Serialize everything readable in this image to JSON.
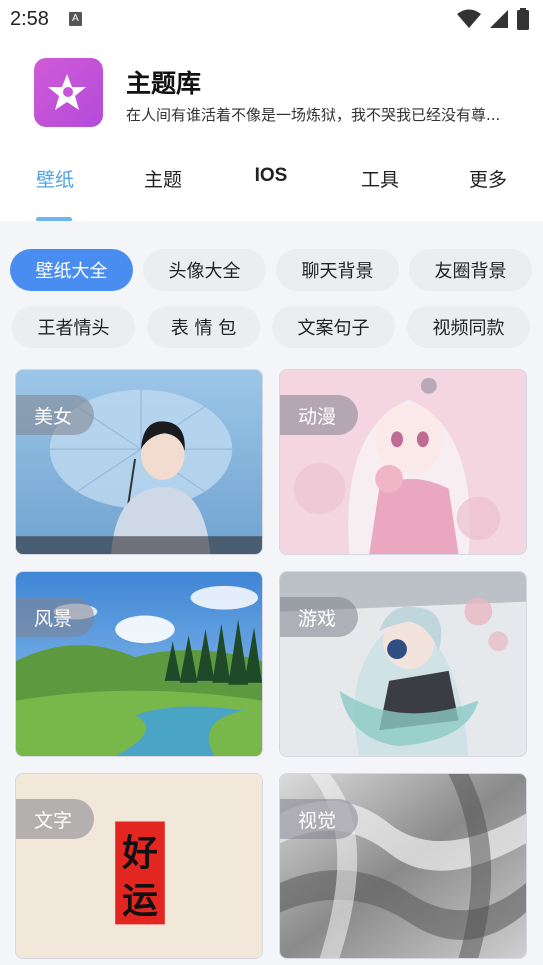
{
  "status_bar": {
    "time": "2:58",
    "icons": [
      "notification-a-icon",
      "wifi-icon",
      "signal-icon",
      "battery-icon"
    ]
  },
  "app": {
    "title": "主题库",
    "subtitle": "在人间有谁活着不像是一场炼狱，我不哭我已经没有尊...",
    "accent_color": "#4a8df0",
    "logo_color": "#c653d9"
  },
  "main_tabs": [
    {
      "label": "壁纸",
      "active": true
    },
    {
      "label": "主题",
      "active": false
    },
    {
      "label": "IOS",
      "active": false
    },
    {
      "label": "工具",
      "active": false
    },
    {
      "label": "更多",
      "active": false
    }
  ],
  "chips": [
    {
      "label": "壁纸大全",
      "active": true
    },
    {
      "label": "头像大全",
      "active": false
    },
    {
      "label": "聊天背景",
      "active": false
    },
    {
      "label": "友圈背景",
      "active": false
    },
    {
      "label": "王者情头",
      "active": false
    },
    {
      "label": "表 情 包",
      "active": false
    },
    {
      "label": "文案句子",
      "active": false
    },
    {
      "label": "视频同款",
      "active": false
    }
  ],
  "cards": [
    {
      "label": "美女"
    },
    {
      "label": "动漫"
    },
    {
      "label": "风景"
    },
    {
      "label": "游戏"
    },
    {
      "label": "文字",
      "art_text_1": "好",
      "art_text_2": "运"
    },
    {
      "label": "视觉"
    }
  ]
}
